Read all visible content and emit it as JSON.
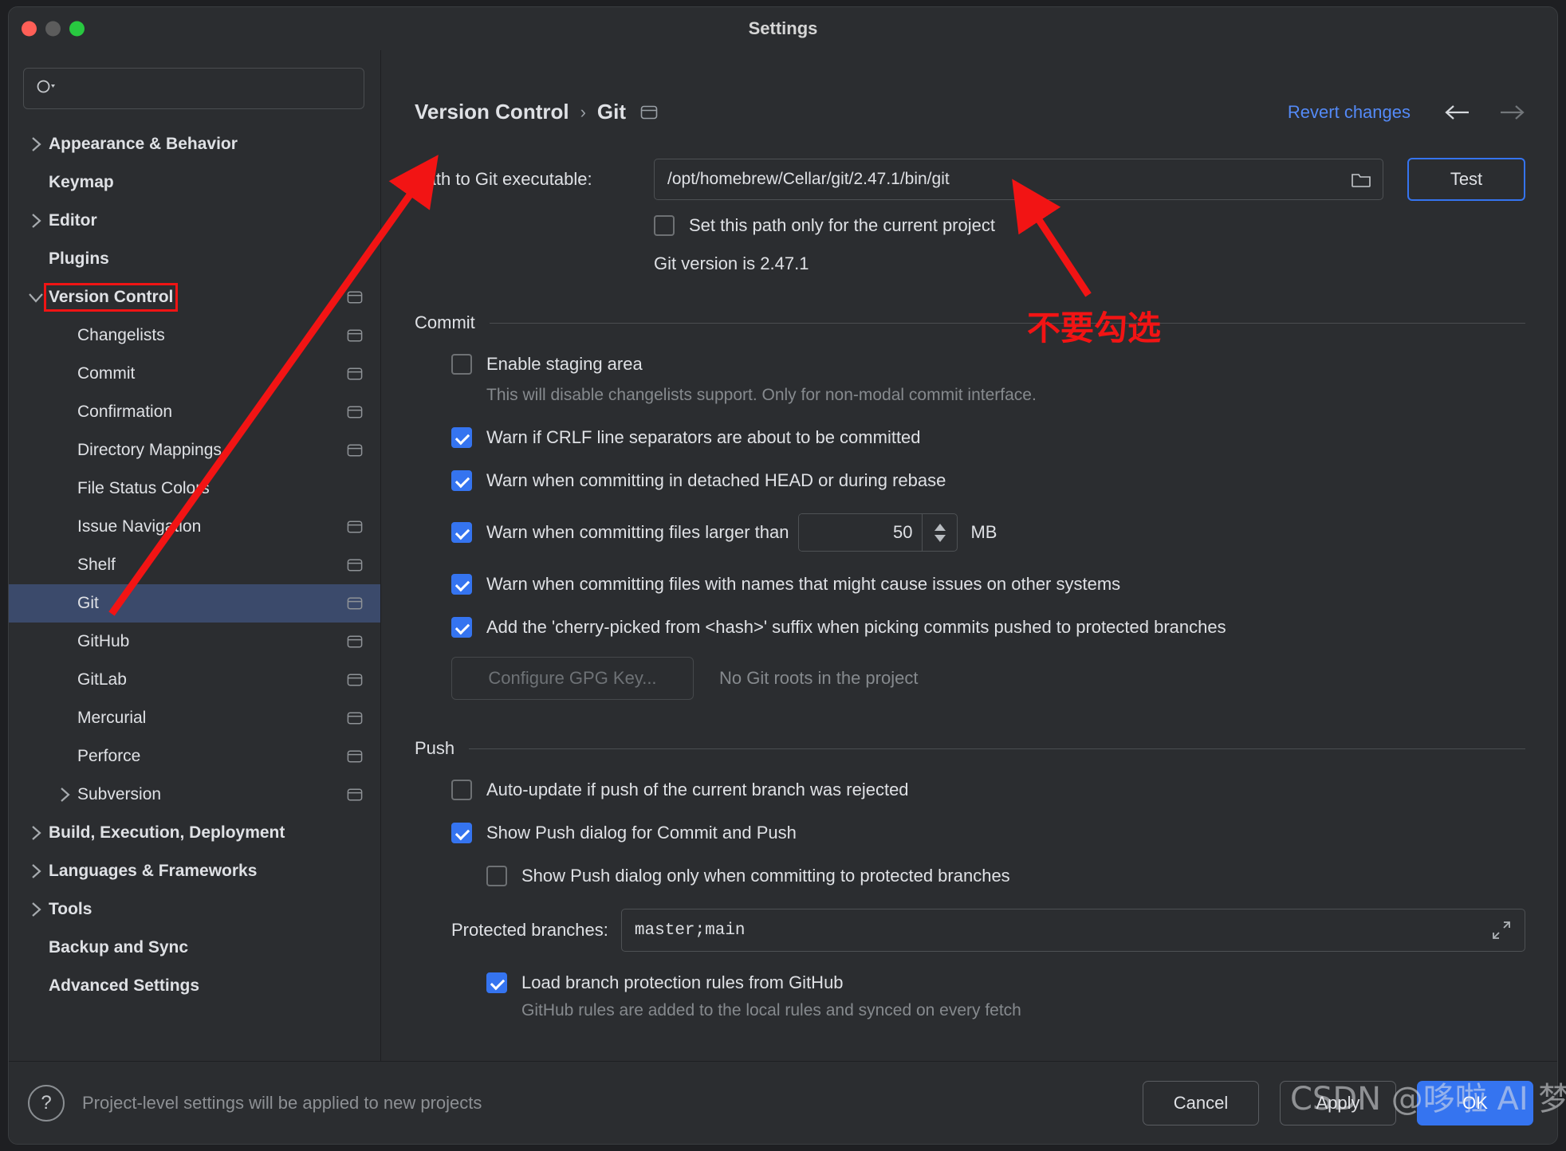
{
  "window": {
    "title": "Settings",
    "traffic_lights": [
      "close-red",
      "minimize-gray",
      "zoom-green"
    ]
  },
  "sidebar": {
    "search": {
      "value": "",
      "placeholder": ""
    },
    "items": [
      {
        "label": "Appearance & Behavior",
        "level": 0,
        "bold": true,
        "chevron": "right",
        "badge": false,
        "selected": false,
        "boxed": false
      },
      {
        "label": "Keymap",
        "level": 0,
        "bold": true,
        "chevron": "none",
        "badge": false,
        "selected": false,
        "boxed": false
      },
      {
        "label": "Editor",
        "level": 0,
        "bold": true,
        "chevron": "right",
        "badge": false,
        "selected": false,
        "boxed": false
      },
      {
        "label": "Plugins",
        "level": 0,
        "bold": true,
        "chevron": "none",
        "badge": false,
        "selected": false,
        "boxed": false
      },
      {
        "label": "Version Control",
        "level": 0,
        "bold": true,
        "chevron": "down",
        "badge": true,
        "selected": false,
        "boxed": true
      },
      {
        "label": "Changelists",
        "level": 1,
        "bold": false,
        "chevron": "none",
        "badge": true,
        "selected": false,
        "boxed": false
      },
      {
        "label": "Commit",
        "level": 1,
        "bold": false,
        "chevron": "none",
        "badge": true,
        "selected": false,
        "boxed": false
      },
      {
        "label": "Confirmation",
        "level": 1,
        "bold": false,
        "chevron": "none",
        "badge": true,
        "selected": false,
        "boxed": false
      },
      {
        "label": "Directory Mappings",
        "level": 1,
        "bold": false,
        "chevron": "none",
        "badge": true,
        "selected": false,
        "boxed": false
      },
      {
        "label": "File Status Colors",
        "level": 1,
        "bold": false,
        "chevron": "none",
        "badge": false,
        "selected": false,
        "boxed": false
      },
      {
        "label": "Issue Navigation",
        "level": 1,
        "bold": false,
        "chevron": "none",
        "badge": true,
        "selected": false,
        "boxed": false
      },
      {
        "label": "Shelf",
        "level": 1,
        "bold": false,
        "chevron": "none",
        "badge": true,
        "selected": false,
        "boxed": false
      },
      {
        "label": "Git",
        "level": 1,
        "bold": false,
        "chevron": "none",
        "badge": true,
        "selected": true,
        "boxed": false
      },
      {
        "label": "GitHub",
        "level": 1,
        "bold": false,
        "chevron": "none",
        "badge": true,
        "selected": false,
        "boxed": false
      },
      {
        "label": "GitLab",
        "level": 1,
        "bold": false,
        "chevron": "none",
        "badge": true,
        "selected": false,
        "boxed": false
      },
      {
        "label": "Mercurial",
        "level": 1,
        "bold": false,
        "chevron": "none",
        "badge": true,
        "selected": false,
        "boxed": false
      },
      {
        "label": "Perforce",
        "level": 1,
        "bold": false,
        "chevron": "none",
        "badge": true,
        "selected": false,
        "boxed": false
      },
      {
        "label": "Subversion",
        "level": 1,
        "bold": false,
        "chevron": "right",
        "badge": true,
        "selected": false,
        "boxed": false
      },
      {
        "label": "Build, Execution, Deployment",
        "level": 0,
        "bold": true,
        "chevron": "right",
        "badge": false,
        "selected": false,
        "boxed": false
      },
      {
        "label": "Languages & Frameworks",
        "level": 0,
        "bold": true,
        "chevron": "right",
        "badge": false,
        "selected": false,
        "boxed": false
      },
      {
        "label": "Tools",
        "level": 0,
        "bold": true,
        "chevron": "right",
        "badge": false,
        "selected": false,
        "boxed": false
      },
      {
        "label": "Backup and Sync",
        "level": 0,
        "bold": true,
        "chevron": "none",
        "badge": false,
        "selected": false,
        "boxed": false
      },
      {
        "label": "Advanced Settings",
        "level": 0,
        "bold": true,
        "chevron": "none",
        "badge": false,
        "selected": false,
        "boxed": false
      }
    ]
  },
  "header": {
    "breadcrumb_parent": "Version Control",
    "breadcrumb_sep": "›",
    "breadcrumb_current": "Git",
    "revert_label": "Revert changes"
  },
  "git_path": {
    "label": "Path to Git executable:",
    "value": "/opt/homebrew/Cellar/git/2.47.1/bin/git",
    "test_button": "Test",
    "project_only_checkbox": {
      "label": "Set this path only for the current project",
      "checked": false
    },
    "version_text": "Git version is 2.47.1"
  },
  "commit": {
    "section_title": "Commit",
    "enable_staging": {
      "label": "Enable staging area",
      "checked": false
    },
    "enable_staging_note": "This will disable changelists support. Only for non-modal commit interface.",
    "options": [
      {
        "label": "Warn if CRLF line separators are about to be committed",
        "checked": true
      },
      {
        "label": "Warn when committing in detached HEAD or during rebase",
        "checked": true
      }
    ],
    "file_size": {
      "label": "Warn when committing files larger than",
      "checked": true,
      "value": "50",
      "unit": "MB"
    },
    "options2": [
      {
        "label": "Warn when committing files with names that might cause issues on other systems",
        "checked": true
      },
      {
        "label": "Add the 'cherry-picked from <hash>' suffix when picking commits pushed to protected branches",
        "checked": true
      }
    ],
    "gpg_button": "Configure GPG Key...",
    "gpg_note": "No Git roots in the project"
  },
  "push": {
    "section_title": "Push",
    "auto_update": {
      "label": "Auto-update if push of the current branch was rejected",
      "checked": false
    },
    "show_push_dialog": {
      "label": "Show Push dialog for Commit and Push",
      "checked": true
    },
    "show_push_protected": {
      "label": "Show Push dialog only when committing to protected branches",
      "checked": false
    },
    "protected_branches_label": "Protected branches:",
    "protected_branches_value": "master;main",
    "load_rules": {
      "label": "Load branch protection rules from GitHub",
      "checked": true
    },
    "load_rules_note": "GitHub rules are added to the local rules and synced on every fetch"
  },
  "footer": {
    "help_glyph": "?",
    "note": "Project-level settings will be applied to new projects",
    "cancel": "Cancel",
    "apply": "Apply",
    "ok": "OK"
  },
  "annotations": {
    "do_not_check": "不要勾选",
    "watermark": "CSDN @哆啦 AI  梦",
    "arrow_color": "#f21414"
  },
  "colors": {
    "accent": "#3574f0",
    "link": "#548af7",
    "selection": "#3b4a6b",
    "background": "#2b2d30",
    "text": "#dfe1e5",
    "muted": "#868a8e",
    "annotation_red": "#f21414"
  }
}
